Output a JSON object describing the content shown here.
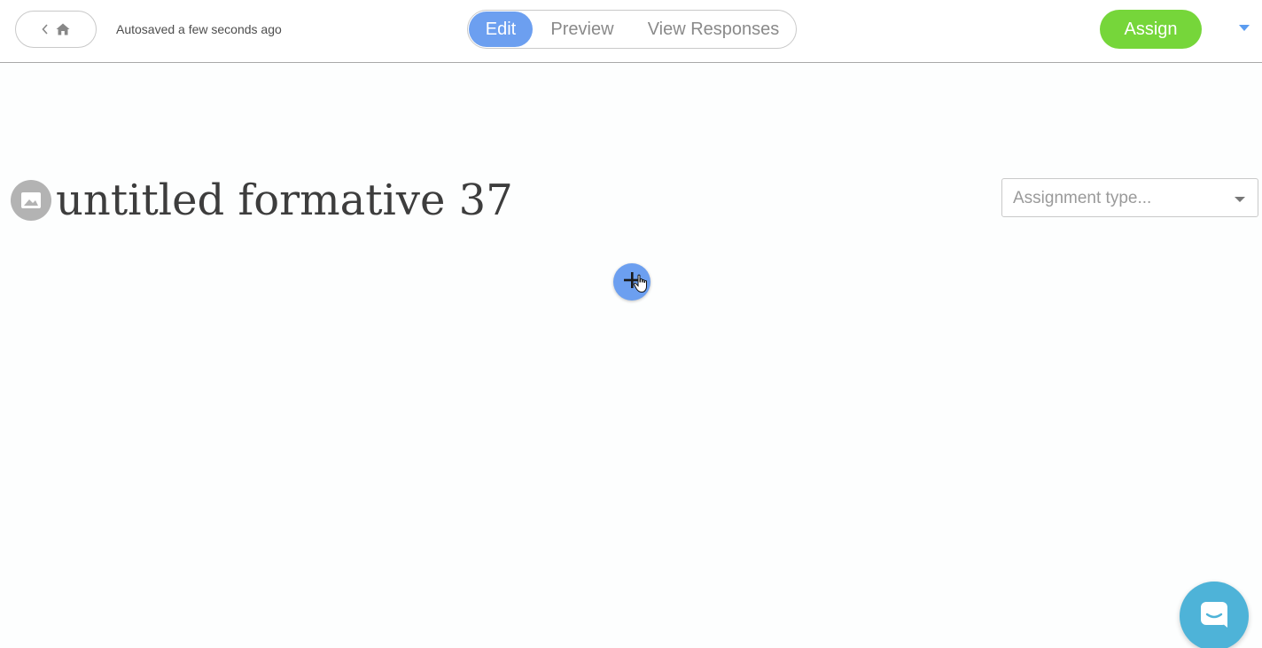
{
  "header": {
    "autosave_text": "Autosaved a few seconds ago",
    "tabs": [
      {
        "label": "Edit",
        "active": true
      },
      {
        "label": "Preview",
        "active": false
      },
      {
        "label": "View Responses",
        "active": false
      }
    ],
    "assign_label": "Assign"
  },
  "main": {
    "title": "untitled formative 37",
    "assignment_type_placeholder": "Assignment type..."
  },
  "icons": {
    "back": "chevron-left-icon",
    "home": "home-icon",
    "image": "image-icon",
    "add": "plus-icon",
    "chat": "chat-icon",
    "dropdown": "caret-down-icon"
  },
  "colors": {
    "accent_blue": "#6c9ff0",
    "assign_green": "#76d63a",
    "chat_teal": "#4eb3d8",
    "title_text": "#3d3d3d"
  }
}
